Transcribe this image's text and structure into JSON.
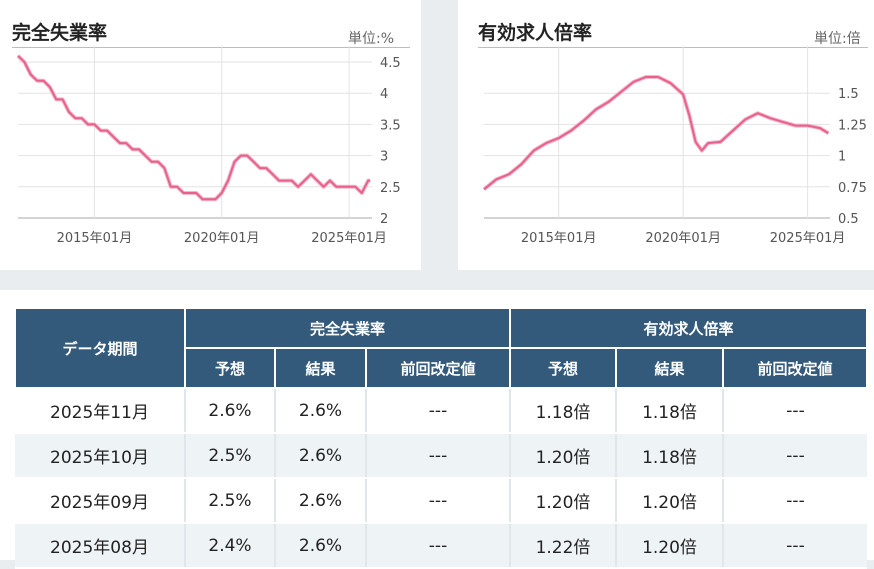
{
  "charts": {
    "unemployment": {
      "title": "完全失業率",
      "unit": "単位:%"
    },
    "jobs_ratio": {
      "title": "有効求人倍率",
      "unit": "単位:倍"
    }
  },
  "chart_data": [
    {
      "type": "line",
      "title": "完全失業率",
      "ylabel": "単位:%",
      "ylim": [
        2,
        4.5
      ],
      "yticks": [
        "4.5",
        "4",
        "3.5",
        "3",
        "2.5",
        "2"
      ],
      "xticks": [
        "2015年01月",
        "2020年01月",
        "2025年01月"
      ],
      "x_range": [
        "2012年01月",
        "2025年11月"
      ],
      "series": [
        {
          "color": "#e8618c",
          "x": [
            2012.0,
            2012.25,
            2012.5,
            2012.75,
            2013.0,
            2013.25,
            2013.5,
            2013.75,
            2014.0,
            2014.25,
            2014.5,
            2014.75,
            2015.0,
            2015.25,
            2015.5,
            2015.75,
            2016.0,
            2016.25,
            2016.5,
            2016.75,
            2017.0,
            2017.25,
            2017.5,
            2017.75,
            2018.0,
            2018.25,
            2018.5,
            2018.75,
            2019.0,
            2019.25,
            2019.5,
            2019.75,
            2020.0,
            2020.25,
            2020.5,
            2020.75,
            2021.0,
            2021.25,
            2021.5,
            2021.75,
            2022.0,
            2022.25,
            2022.5,
            2022.75,
            2023.0,
            2023.25,
            2023.5,
            2023.75,
            2024.0,
            2024.25,
            2024.5,
            2024.75,
            2025.0,
            2025.25,
            2025.5,
            2025.75,
            2025.83
          ],
          "values": [
            4.6,
            4.5,
            4.3,
            4.2,
            4.2,
            4.1,
            3.9,
            3.9,
            3.7,
            3.6,
            3.6,
            3.5,
            3.5,
            3.4,
            3.4,
            3.3,
            3.2,
            3.2,
            3.1,
            3.1,
            3.0,
            2.9,
            2.9,
            2.8,
            2.5,
            2.5,
            2.4,
            2.4,
            2.4,
            2.3,
            2.3,
            2.3,
            2.4,
            2.6,
            2.9,
            3.0,
            3.0,
            2.9,
            2.8,
            2.8,
            2.7,
            2.6,
            2.6,
            2.6,
            2.5,
            2.6,
            2.7,
            2.6,
            2.5,
            2.6,
            2.5,
            2.5,
            2.5,
            2.5,
            2.4,
            2.6,
            2.6
          ]
        }
      ]
    },
    {
      "type": "line",
      "title": "有効求人倍率",
      "ylabel": "単位:倍",
      "ylim": [
        0.5,
        1.75
      ],
      "yticks": [
        "1.5",
        "1.25",
        "1",
        "0.75",
        "0.5"
      ],
      "xticks": [
        "2015年01月",
        "2020年01月",
        "2025年01月"
      ],
      "x_range": [
        "2012年01月",
        "2025年11月"
      ],
      "series": [
        {
          "color": "#e8618c",
          "x": [
            2012.0,
            2012.5,
            2013.0,
            2013.5,
            2014.0,
            2014.5,
            2015.0,
            2015.5,
            2016.0,
            2016.5,
            2017.0,
            2017.5,
            2018.0,
            2018.5,
            2019.0,
            2019.5,
            2020.0,
            2020.25,
            2020.5,
            2020.75,
            2021.0,
            2021.5,
            2022.0,
            2022.5,
            2023.0,
            2023.5,
            2024.0,
            2024.5,
            2025.0,
            2025.5,
            2025.83
          ],
          "values": [
            0.73,
            0.81,
            0.85,
            0.93,
            1.04,
            1.1,
            1.14,
            1.2,
            1.28,
            1.37,
            1.43,
            1.51,
            1.59,
            1.63,
            1.63,
            1.58,
            1.49,
            1.32,
            1.11,
            1.04,
            1.1,
            1.11,
            1.2,
            1.29,
            1.34,
            1.3,
            1.27,
            1.24,
            1.24,
            1.22,
            1.18
          ]
        }
      ]
    }
  ],
  "table": {
    "period_header": "データ期間",
    "groups": [
      "完全失業率",
      "有効求人倍率"
    ],
    "subheaders": [
      "予想",
      "結果",
      "前回改定値",
      "予想",
      "結果",
      "前回改定値"
    ],
    "rows": [
      [
        "2025年11月",
        "2.6%",
        "2.6%",
        "---",
        "1.18倍",
        "1.18倍",
        "---"
      ],
      [
        "2025年10月",
        "2.5%",
        "2.6%",
        "---",
        "1.20倍",
        "1.18倍",
        "---"
      ],
      [
        "2025年09月",
        "2.5%",
        "2.6%",
        "---",
        "1.20倍",
        "1.20倍",
        "---"
      ],
      [
        "2025年08月",
        "2.4%",
        "2.6%",
        "---",
        "1.22倍",
        "1.20倍",
        "---"
      ]
    ]
  }
}
